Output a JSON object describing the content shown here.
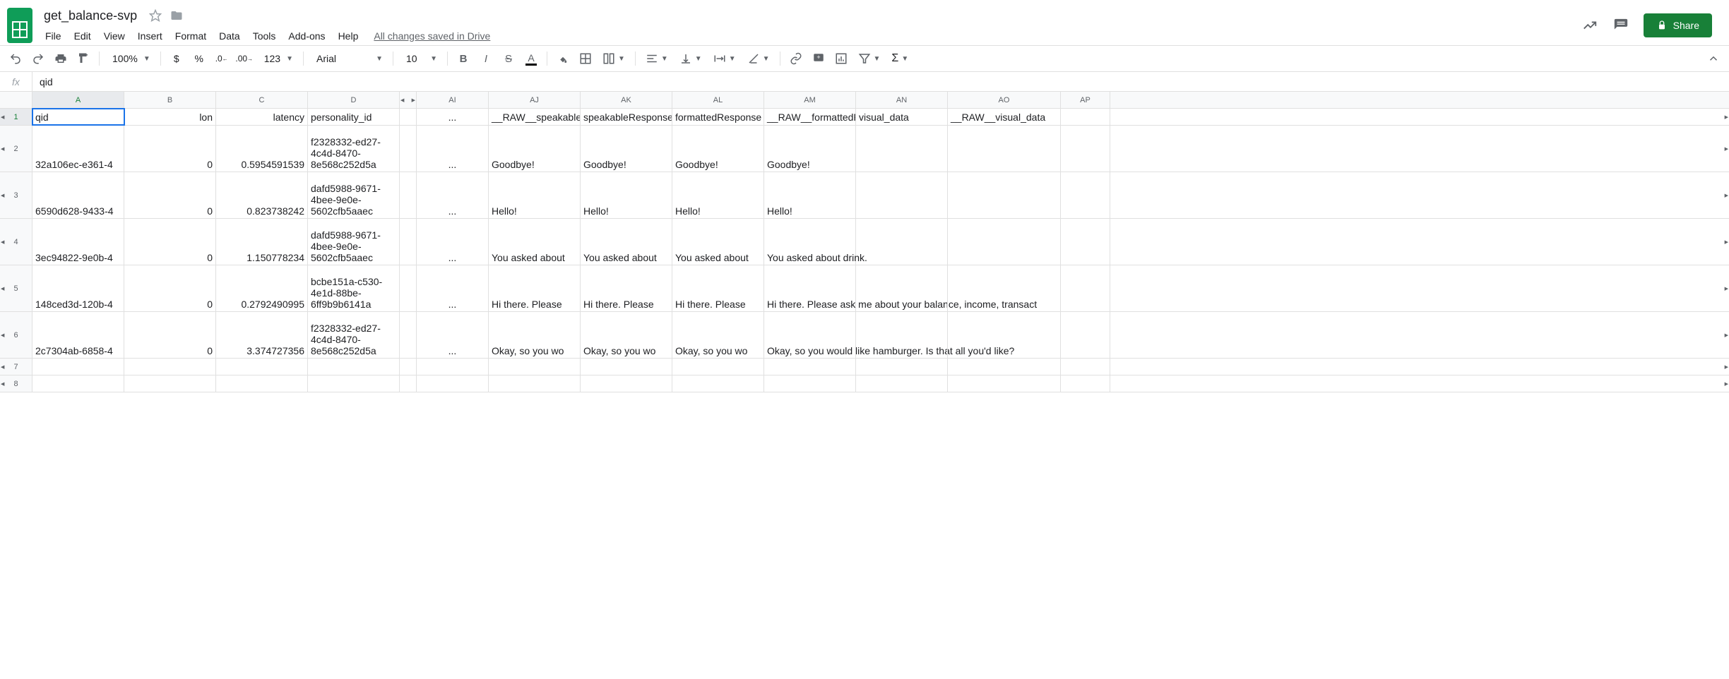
{
  "doc": {
    "title": "get_balance-svp",
    "drive_status": "All changes saved in Drive"
  },
  "menus": {
    "file": "File",
    "edit": "Edit",
    "view": "View",
    "insert": "Insert",
    "format": "Format",
    "data": "Data",
    "tools": "Tools",
    "addons": "Add-ons",
    "help": "Help"
  },
  "toolbar": {
    "zoom": "100%",
    "font": "Arial",
    "size": "10",
    "share": "Share"
  },
  "formula": {
    "value": "qid"
  },
  "col_labels": {
    "a": "A",
    "b": "B",
    "c": "C",
    "d": "D",
    "ai": "AI",
    "aj": "AJ",
    "ak": "AK",
    "al": "AL",
    "am": "AM",
    "an": "AN",
    "ao": "AO",
    "ap": "AP"
  },
  "row_labels": {
    "r1": "1",
    "r2": "2",
    "r3": "3",
    "r4": "4",
    "r5": "5",
    "r6": "6",
    "r7": "7",
    "r8": "8"
  },
  "headers": {
    "a": "qid",
    "b": "lon",
    "c": "latency",
    "d": "personality_id",
    "ai": "...",
    "aj": "__RAW__speakableResponse",
    "ak": "speakableResponse",
    "al": "formattedResponse",
    "am": "__RAW__formattedResponse",
    "an": "visual_data",
    "ao": "__RAW__visual_data"
  },
  "rows": [
    {
      "a": "32a106ec-e361-4",
      "b": "0",
      "c": "0.5954591539",
      "d": "f2328332-ed27-4c4d-8470-8e568c252d5a",
      "ai": "...",
      "aj": "Goodbye!",
      "ak": "Goodbye!",
      "al": "Goodbye!",
      "am": "Goodbye!"
    },
    {
      "a": "6590d628-9433-4",
      "b": "0",
      "c": "0.823738242",
      "d": "dafd5988-9671-4bee-9e0e-5602cfb5aaec",
      "ai": "...",
      "aj": "Hello!",
      "ak": "Hello!",
      "al": "Hello!",
      "am": "Hello!"
    },
    {
      "a": "3ec94822-9e0b-4",
      "b": "0",
      "c": "1.150778234",
      "d": "dafd5988-9671-4bee-9e0e-5602cfb5aaec",
      "ai": "...",
      "aj": "You asked about",
      "ak": "You asked about",
      "al": "You asked about",
      "am": "You asked about drink."
    },
    {
      "a": "148ced3d-120b-4",
      "b": "0",
      "c": "0.2792490995",
      "d": "bcbe151a-c530-4e1d-88be-6ff9b9b6141a",
      "ai": "...",
      "aj": "Hi there. Please ",
      "ak": "Hi there. Please ",
      "al": "Hi there. Please ",
      "am": "Hi there. Please ask me about your balance, income, transact"
    },
    {
      "a": "2c7304ab-6858-4",
      "b": "0",
      "c": "3.374727356",
      "d": "f2328332-ed27-4c4d-8470-8e568c252d5a",
      "ai": "...",
      "aj": "Okay, so you wo",
      "ak": "Okay, so you wo",
      "al": "Okay, so you wo",
      "am": "Okay, so you would like hamburger. Is that all you'd like?"
    }
  ]
}
